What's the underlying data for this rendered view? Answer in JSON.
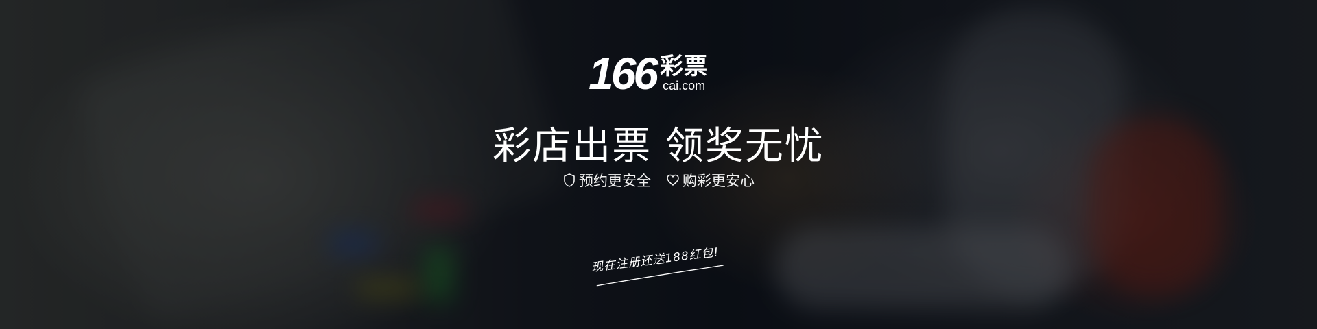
{
  "logo": {
    "number": "166",
    "cn_name": "彩票",
    "domain": "cai.com"
  },
  "headline": "彩店出票 领奖无忧",
  "features": [
    {
      "icon": "shield-icon",
      "label": "预约更安全"
    },
    {
      "icon": "heart-icon",
      "label": "购彩更安心"
    }
  ],
  "promo": {
    "text": "现在注册还送188红包!"
  },
  "colors": {
    "text": "#ffffff",
    "background": "#0b0e14"
  }
}
